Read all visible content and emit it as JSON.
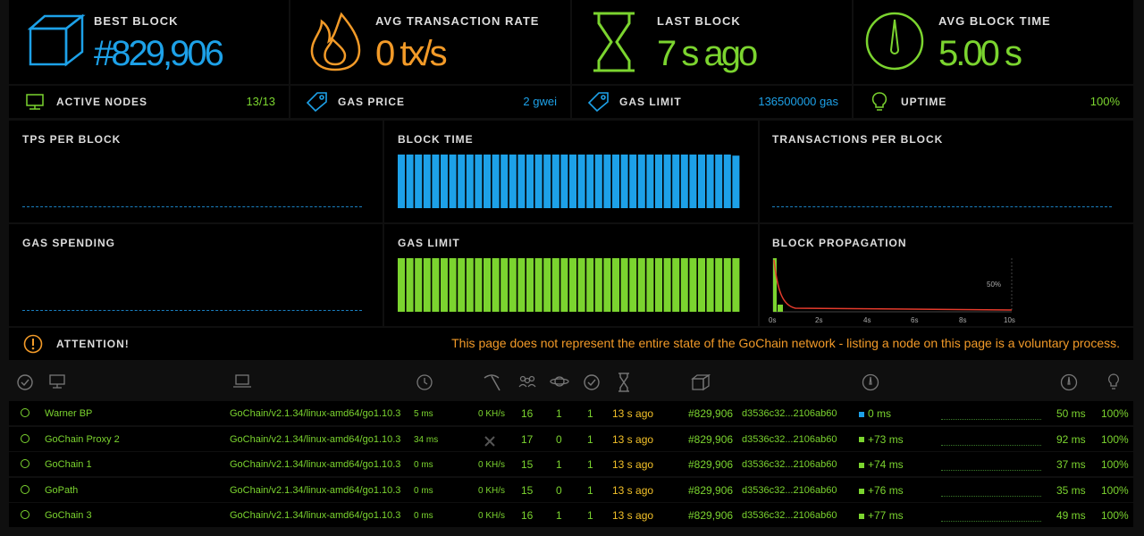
{
  "top_stats": [
    {
      "label": "BEST BLOCK",
      "value": "#829,906",
      "color": "#1da1e8",
      "icon": "cube-icon"
    },
    {
      "label": "AVG TRANSACTION RATE",
      "value": "0 tx/s",
      "color": "#f29a28",
      "icon": "fire-icon"
    },
    {
      "label": "LAST BLOCK",
      "value": "7 s ago",
      "color": "#7bd42f",
      "icon": "hourglass-icon"
    },
    {
      "label": "AVG BLOCK TIME",
      "value": "5.00 s",
      "color": "#7bd42f",
      "icon": "gauge-icon"
    }
  ],
  "mini_stats": [
    {
      "label": "ACTIVE NODES",
      "value": "13/13",
      "color": "#7bd42f",
      "icon": "monitor-icon"
    },
    {
      "label": "GAS PRICE",
      "value": "2 gwei",
      "color": "#1da1e8",
      "icon": "tag-icon"
    },
    {
      "label": "GAS LIMIT",
      "value": "136500000 gas",
      "color": "#1da1e8",
      "icon": "tag-icon"
    },
    {
      "label": "UPTIME",
      "value": "100%",
      "color": "#7bd42f",
      "icon": "bulb-icon"
    }
  ],
  "charts": {
    "tps_title": "TPS PER BLOCK",
    "block_time_title": "BLOCK TIME",
    "tx_per_block_title": "TRANSACTIONS PER BLOCK",
    "gas_spending_title": "GAS SPENDING",
    "gas_limit_title": "GAS LIMIT",
    "block_prop_title": "BLOCK PROPAGATION",
    "prop_label": "50%",
    "prop_ticks": [
      "0s",
      "2s",
      "4s",
      "6s",
      "8s",
      "10s"
    ]
  },
  "chart_data": [
    {
      "type": "bar",
      "title": "BLOCK TIME",
      "values": [
        5,
        5,
        5,
        5,
        5,
        5,
        5,
        5,
        5,
        5,
        5,
        5,
        5,
        5,
        5,
        5,
        5,
        5,
        5,
        5,
        5,
        5,
        5,
        5,
        5,
        5,
        5,
        5,
        5,
        5,
        5,
        5,
        5,
        5,
        5,
        5,
        5,
        5,
        5,
        4.9
      ],
      "color": "#1da1e8"
    },
    {
      "type": "bar",
      "title": "GAS LIMIT",
      "values": [
        1,
        1,
        1,
        1,
        1,
        1,
        1,
        1,
        1,
        1,
        1,
        1,
        1,
        1,
        1,
        1,
        1,
        1,
        1,
        1,
        1,
        1,
        1,
        1,
        1,
        1,
        1,
        1,
        1,
        1,
        1,
        1,
        1,
        1,
        1,
        1,
        1,
        1,
        1,
        1
      ],
      "color": "#7bd42f"
    },
    {
      "type": "line",
      "title": "BLOCK PROPAGATION",
      "x": [
        0,
        0.2,
        0.4,
        0.6,
        1,
        2,
        4,
        6,
        8,
        10
      ],
      "values": [
        100,
        55,
        25,
        12,
        6,
        4,
        3,
        3,
        3,
        3
      ],
      "xticks": [
        "0s",
        "2s",
        "4s",
        "6s",
        "8s",
        "10s"
      ],
      "color": "#e53b2c"
    }
  ],
  "attention": {
    "label": "ATTENTION!",
    "message": "This page does not represent the entire state of the GoChain network - listing a node on this page is a voluntary process."
  },
  "nodes": [
    {
      "name": "Warner BP",
      "client": "GoChain/v2.1.34/linux-amd64/go1.10.3",
      "latency": "5 ms",
      "hashrate": "0 KH/s",
      "peers": "16",
      "pending": "1",
      "uncles": "1",
      "last": "13 s ago",
      "block": "#829,906",
      "hash": "d3536c32...2106ab60",
      "prop": "0 ms",
      "propcolor": "#1da1e8",
      "avg": "50 ms",
      "uptime": "100%"
    },
    {
      "name": "GoChain Proxy 2",
      "client": "GoChain/v2.1.34/linux-amd64/go1.10.3",
      "latency": "34 ms",
      "hashrate": "",
      "peers": "17",
      "pending": "0",
      "uncles": "1",
      "last": "13 s ago",
      "block": "#829,906",
      "hash": "d3536c32...2106ab60",
      "prop": "+73 ms",
      "propcolor": "#7bd42f",
      "avg": "92 ms",
      "uptime": "100%"
    },
    {
      "name": "GoChain 1",
      "client": "GoChain/v2.1.34/linux-amd64/go1.10.3",
      "latency": "0 ms",
      "hashrate": "0 KH/s",
      "peers": "15",
      "pending": "1",
      "uncles": "1",
      "last": "13 s ago",
      "block": "#829,906",
      "hash": "d3536c32...2106ab60",
      "prop": "+74 ms",
      "propcolor": "#7bd42f",
      "avg": "37 ms",
      "uptime": "100%"
    },
    {
      "name": "GoPath",
      "client": "GoChain/v2.1.34/linux-amd64/go1.10.3",
      "latency": "0 ms",
      "hashrate": "0 KH/s",
      "peers": "15",
      "pending": "0",
      "uncles": "1",
      "last": "13 s ago",
      "block": "#829,906",
      "hash": "d3536c32...2106ab60",
      "prop": "+76 ms",
      "propcolor": "#7bd42f",
      "avg": "35 ms",
      "uptime": "100%"
    },
    {
      "name": "GoChain 3",
      "client": "GoChain/v2.1.34/linux-amd64/go1.10.3",
      "latency": "0 ms",
      "hashrate": "0 KH/s",
      "peers": "16",
      "pending": "1",
      "uncles": "1",
      "last": "13 s ago",
      "block": "#829,906",
      "hash": "d3536c32...2106ab60",
      "prop": "+77 ms",
      "propcolor": "#7bd42f",
      "avg": "49 ms",
      "uptime": "100%"
    }
  ]
}
